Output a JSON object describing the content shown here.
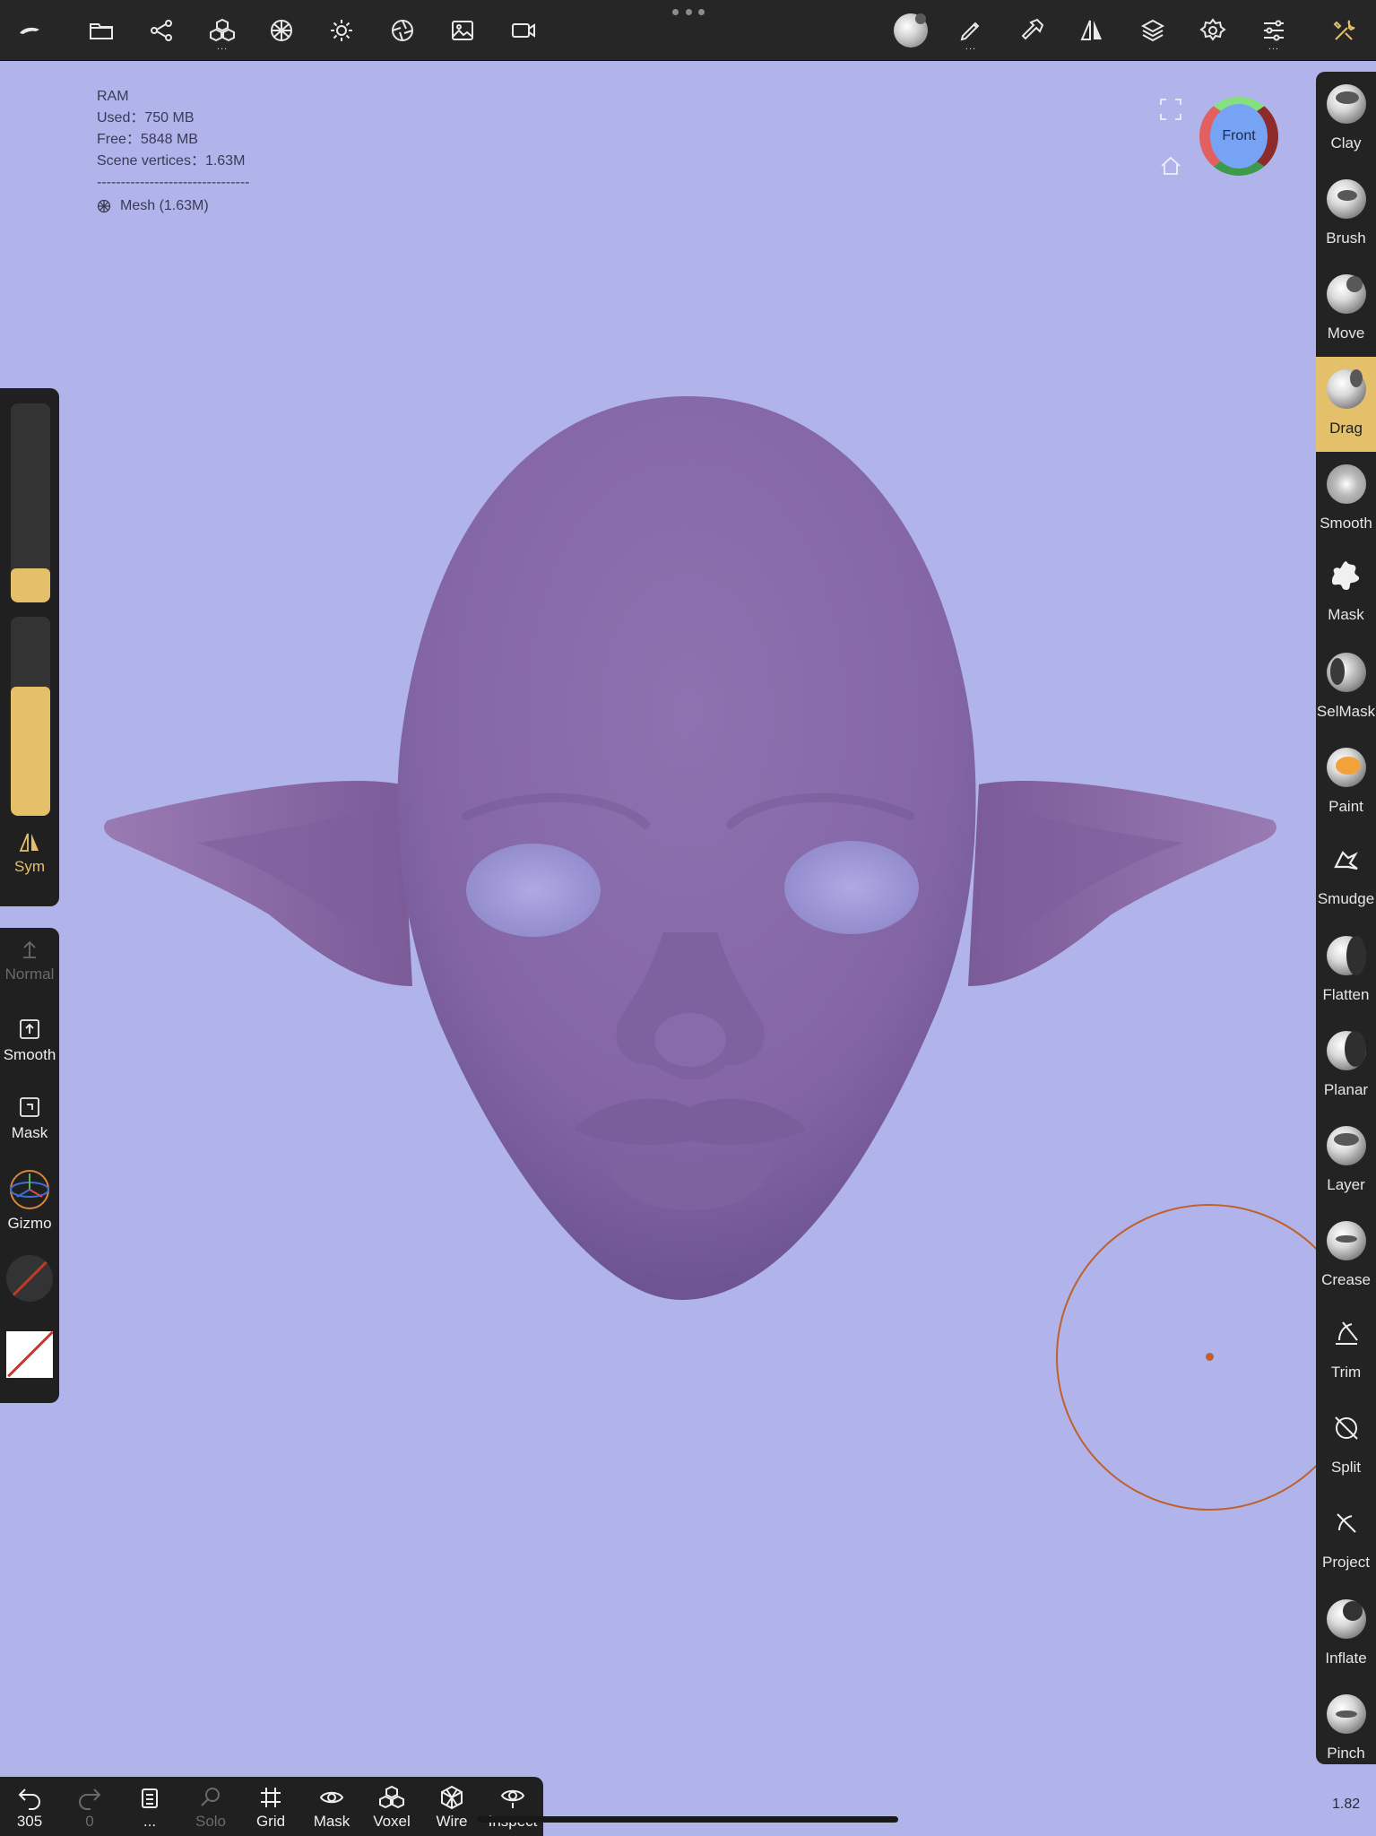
{
  "top_toolbar": {
    "left_icons": [
      "app-logo-icon",
      "folder-icon",
      "scene-graph-icon",
      "primitives-icon",
      "topology-icon",
      "light-icon",
      "material-icon",
      "background-image-icon",
      "camera-icon"
    ],
    "right_icons": [
      "material-sphere-icon",
      "paint-brush-icon",
      "hammer-icon",
      "symmetry-icon",
      "layers-icon",
      "settings-icon",
      "sliders-icon",
      "tools-icon"
    ]
  },
  "info": {
    "ram_label": "RAM",
    "used": "Used：750 MB",
    "free": "Free：5848 MB",
    "scene_vertices": "Scene vertices：1.63M",
    "separator": "--------------------------------",
    "mesh": "Mesh (1.63M)"
  },
  "gizmo": {
    "label": "Front"
  },
  "left_panel": {
    "radius_slider_level": 0.17,
    "intensity_slider_level": 0.65,
    "sym_label": "Sym",
    "normal_label": "Normal",
    "smooth_label": "Smooth",
    "mask_label": "Mask",
    "gizmo_label": "Gizmo"
  },
  "tools": [
    {
      "label": "Clay",
      "icon": "clay-sphere-icon",
      "active": false
    },
    {
      "label": "Brush",
      "icon": "brush-sphere-icon",
      "active": false
    },
    {
      "label": "Move",
      "icon": "move-sphere-icon",
      "active": false
    },
    {
      "label": "Drag",
      "icon": "drag-sphere-icon",
      "active": true
    },
    {
      "label": "Smooth",
      "icon": "smooth-sphere-icon",
      "active": false
    },
    {
      "label": "Mask",
      "icon": "mask-splat-icon",
      "active": false
    },
    {
      "label": "SelMask",
      "icon": "selmask-sphere-icon",
      "active": false
    },
    {
      "label": "Paint",
      "icon": "paint-sphere-icon",
      "active": false
    },
    {
      "label": "Smudge",
      "icon": "smudge-icon",
      "active": false
    },
    {
      "label": "Flatten",
      "icon": "flatten-sphere-icon",
      "active": false
    },
    {
      "label": "Planar",
      "icon": "planar-sphere-icon",
      "active": false
    },
    {
      "label": "Layer",
      "icon": "layer-sphere-icon",
      "active": false
    },
    {
      "label": "Crease",
      "icon": "crease-sphere-icon",
      "active": false
    },
    {
      "label": "Trim",
      "icon": "trim-icon",
      "active": false
    },
    {
      "label": "Split",
      "icon": "split-icon",
      "active": false
    },
    {
      "label": "Project",
      "icon": "project-icon",
      "active": false
    },
    {
      "label": "Inflate",
      "icon": "inflate-sphere-icon",
      "active": false
    },
    {
      "label": "Pinch",
      "icon": "pinch-sphere-icon",
      "active": false
    }
  ],
  "bottom_bar": {
    "undo_count": "305",
    "redo_count": "0",
    "more": "...",
    "solo": "Solo",
    "grid": "Grid",
    "mask": "Mask",
    "voxel": "Voxel",
    "wire": "Wire",
    "inspect": "Inspect"
  },
  "version": "1.82",
  "colors": {
    "background": "#b0b4ea",
    "accent": "#e5c06b",
    "toolbar": "#262626",
    "model": "#8c6fae",
    "brush_cursor": "#c0602b"
  }
}
